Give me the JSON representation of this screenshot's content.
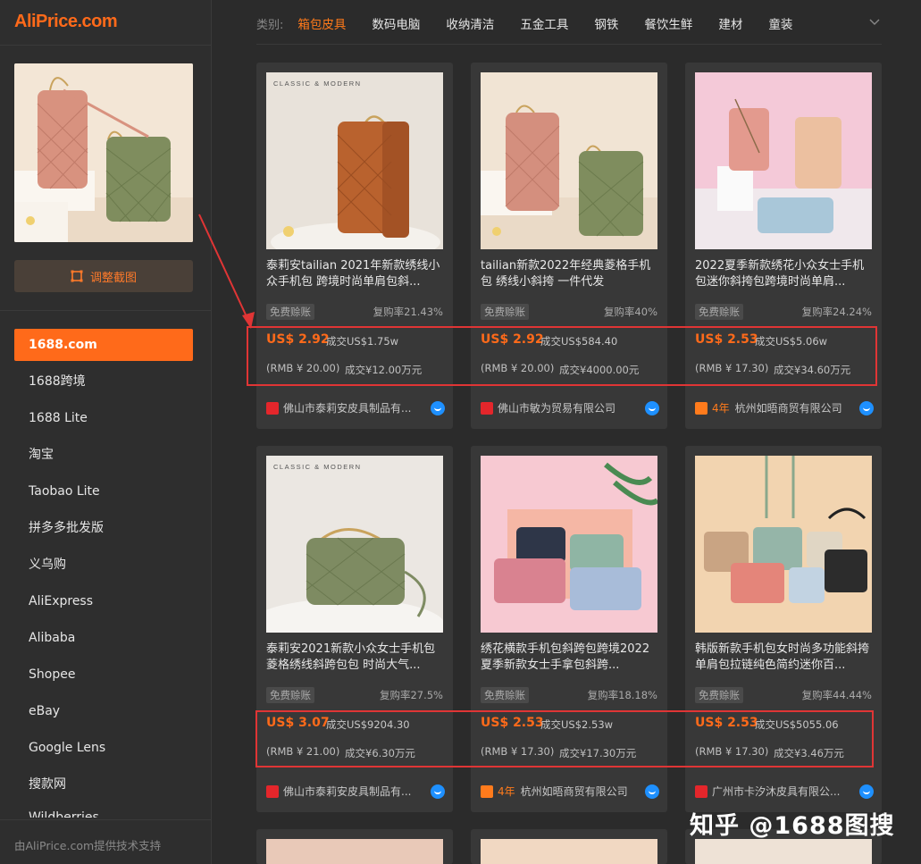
{
  "brand": {
    "logo": "AliPrice.com"
  },
  "sidebar": {
    "adjust_button": "调整截图",
    "sources": [
      {
        "label": "1688.com",
        "active": true
      },
      {
        "label": "1688跨境"
      },
      {
        "label": "1688 Lite"
      },
      {
        "label": "淘宝"
      },
      {
        "label": "Taobao Lite"
      },
      {
        "label": "拼多多批发版"
      },
      {
        "label": "义乌购"
      },
      {
        "label": "AliExpress"
      },
      {
        "label": "Alibaba"
      },
      {
        "label": "Shopee"
      },
      {
        "label": "eBay"
      },
      {
        "label": "Google Lens"
      },
      {
        "label": "搜款网"
      },
      {
        "label": "Wildberries"
      }
    ],
    "footer": "由AliPrice.com提供技术支持"
  },
  "categories": {
    "label": "类别:",
    "items": [
      "箱包皮具",
      "数码电脑",
      "收纳清洁",
      "五金工具",
      "钢铁",
      "餐饮生鲜",
      "建材",
      "童装"
    ],
    "active_index": 0
  },
  "products": [
    {
      "title": "泰莉安tailian 2021年新款绣线小众手机包 跨境时尚单肩包斜...",
      "badge": "免费赊账",
      "repurchase": "复购率21.43%",
      "price": "US$ 2.92",
      "deal_usd": "成交US$1.75w",
      "rmb": "(RMB ¥ 20.00)",
      "deal_rmb": "成交¥12.00万元",
      "store": "佛山市泰莉安皮具制品有...",
      "years": "",
      "store_icon": "red"
    },
    {
      "title": "tailian新款2022年经典菱格手机包 绣线小斜挎 一件代发",
      "badge": "免费赊账",
      "repurchase": "复购率40%",
      "price": "US$ 2.92",
      "deal_usd": "成交US$584.40",
      "rmb": "(RMB ¥ 20.00)",
      "deal_rmb": "成交¥4000.00元",
      "store": "佛山市敏为贸易有限公司",
      "years": "",
      "store_icon": "red"
    },
    {
      "title": "2022夏季新款绣花小众女士手机包迷你斜挎包跨境时尚单肩...",
      "badge": "免费赊账",
      "repurchase": "复购率24.24%",
      "price": "US$ 2.53",
      "deal_usd": "成交US$5.06w",
      "rmb": "(RMB ¥ 17.30)",
      "deal_rmb": "成交¥34.60万元",
      "store": "杭州如晤商贸有限公司",
      "years": "4年",
      "store_icon": "orange"
    },
    {
      "title": "泰莉安2021新款小众女士手机包 菱格绣线斜跨包包 时尚大气...",
      "badge": "免费赊账",
      "repurchase": "复购率27.5%",
      "price": "US$ 3.07",
      "deal_usd": "成交US$9204.30",
      "rmb": "(RMB ¥ 21.00)",
      "deal_rmb": "成交¥6.30万元",
      "store": "佛山市泰莉安皮具制品有...",
      "years": "",
      "store_icon": "red"
    },
    {
      "title": "绣花横款手机包斜跨包跨境2022夏季新款女士手拿包斜跨...",
      "badge": "免费赊账",
      "repurchase": "复购率18.18%",
      "price": "US$ 2.53",
      "deal_usd": "成交US$2.53w",
      "rmb": "(RMB ¥ 17.30)",
      "deal_rmb": "成交¥17.30万元",
      "store": "杭州如晤商贸有限公司",
      "years": "4年",
      "store_icon": "orange"
    },
    {
      "title": "韩版新款手机包女时尚多功能斜挎单肩包拉链纯色简约迷你百...",
      "badge": "免费赊账",
      "repurchase": "复购率44.44%",
      "price": "US$ 2.53",
      "deal_usd": "成交US$5055.06",
      "rmb": "(RMB ¥ 17.30)",
      "deal_rmb": "成交¥3.46万元",
      "store": "广州市卡汐沐皮具有限公...",
      "years": "",
      "store_icon": "red"
    }
  ],
  "image_text": {
    "brand_tag": "CLASSIC & MODERN"
  },
  "watermark": "知乎 @1688图搜",
  "colors": {
    "accent": "#ff6a1a",
    "annotation": "#e03535",
    "chat": "#1e90ff"
  }
}
